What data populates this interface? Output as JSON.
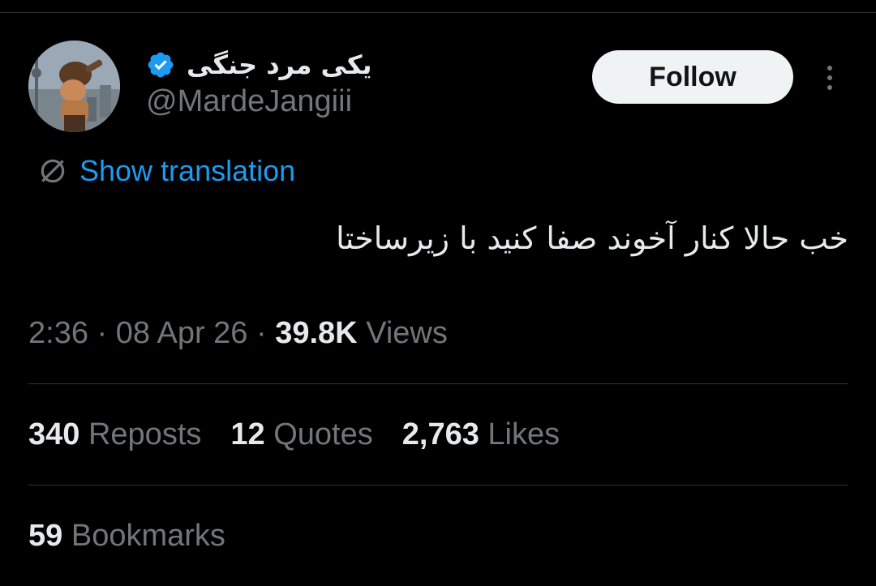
{
  "author": {
    "display_name": "یکی مرد جنگی",
    "handle": "@MardeJangiii",
    "verified": true,
    "avatar_icon": "avatar-image",
    "verified_icon": "verified-badge-icon"
  },
  "actions": {
    "follow_label": "Follow",
    "more_icon": "more-options-icon"
  },
  "translation": {
    "label": "Show translation",
    "icon": "globe-icon"
  },
  "tweet": {
    "text": "خب حالا کنار آخوند صفا کنید با زیرساختا"
  },
  "meta": {
    "time": "2:36",
    "separator": "·",
    "date": "08 Apr 26",
    "views_count": "39.8K",
    "views_label": "Views"
  },
  "stats": {
    "reposts_count": "340",
    "reposts_label": "Reposts",
    "quotes_count": "12",
    "quotes_label": "Quotes",
    "likes_count": "2,763",
    "likes_label": "Likes",
    "bookmarks_count": "59",
    "bookmarks_label": "Bookmarks"
  },
  "colors": {
    "background": "#000000",
    "text_primary": "#e7e9ea",
    "text_secondary": "#71767b",
    "accent": "#1d9bf0",
    "divider": "#2f3336",
    "follow_bg": "#eff3f4"
  }
}
